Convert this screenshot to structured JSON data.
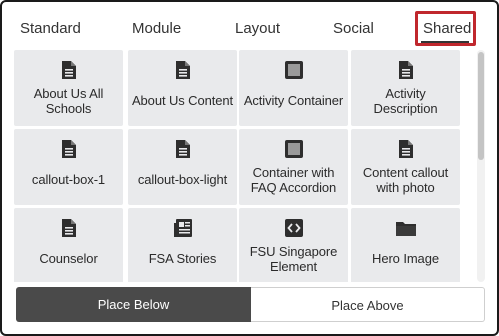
{
  "tabs": [
    {
      "label": "Standard"
    },
    {
      "label": "Module"
    },
    {
      "label": "Layout"
    },
    {
      "label": "Social"
    },
    {
      "label": "Shared",
      "active": true
    }
  ],
  "highlight_color": "#c0272d",
  "tiles": [
    {
      "label": "About Us All Schools",
      "icon": "document-icon"
    },
    {
      "label": "About Us Content",
      "icon": "document-icon"
    },
    {
      "label": "Activity Container",
      "icon": "square-icon"
    },
    {
      "label": "Activity Description",
      "icon": "document-icon"
    },
    {
      "label": "callout-box-1",
      "icon": "document-icon"
    },
    {
      "label": "callout-box-light",
      "icon": "document-icon"
    },
    {
      "label": "Container with FAQ Accordion",
      "icon": "square-icon"
    },
    {
      "label": "Content callout with photo",
      "icon": "document-icon"
    },
    {
      "label": "Counselor",
      "icon": "document-icon"
    },
    {
      "label": "FSA Stories",
      "icon": "newspaper-icon"
    },
    {
      "label": "FSU Singapore Element",
      "icon": "code-icon"
    },
    {
      "label": "Hero Image",
      "icon": "folder-icon"
    }
  ],
  "buttons": {
    "place_below": "Place Below",
    "place_above": "Place Above"
  },
  "colors": {
    "tile_bg": "#e9eaec",
    "primary_button": "#4a4a4a"
  }
}
